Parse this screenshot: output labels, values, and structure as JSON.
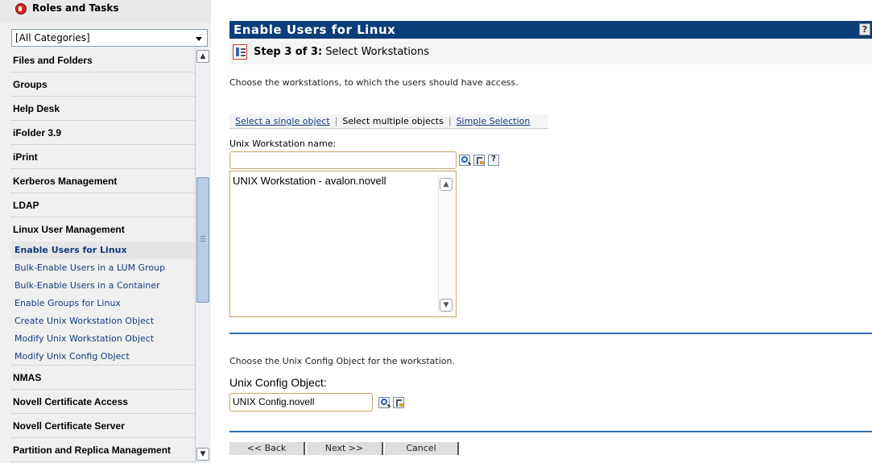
{
  "sidebar": {
    "header_title": "Roles and Tasks",
    "category_select": {
      "value": "[All Categories]"
    },
    "items": [
      {
        "label": "Files and Folders"
      },
      {
        "label": "Groups"
      },
      {
        "label": "Help Desk"
      },
      {
        "label": "iFolder 3.9"
      },
      {
        "label": "iPrint"
      },
      {
        "label": "Kerberos Management"
      },
      {
        "label": "LDAP"
      },
      {
        "label": "Linux User Management"
      },
      {
        "label": "NMAS"
      },
      {
        "label": "Novell Certificate Access"
      },
      {
        "label": "Novell Certificate Server"
      },
      {
        "label": "Partition and Replica Management"
      }
    ],
    "subitems": [
      {
        "label": "Enable Users for Linux"
      },
      {
        "label": "Bulk-Enable Users in a LUM Group"
      },
      {
        "label": "Bulk-Enable Users in a Container"
      },
      {
        "label": "Enable Groups for Linux"
      },
      {
        "label": "Create Unix Workstation Object"
      },
      {
        "label": "Modify Unix Workstation Object"
      },
      {
        "label": "Modify Unix Config Object"
      }
    ]
  },
  "main": {
    "title": "Enable Users for Linux",
    "help_label": "?",
    "step_prefix": "Step 3 of 3:",
    "step_title": "Select Workstations",
    "workstation_description": "Choose the workstations, to which the users should have access.",
    "selection_tabs": {
      "single": "Select a single object",
      "multiple": "Select multiple objects",
      "simple": "Simple Selection"
    },
    "workstation_field_label": "Unix Workstation name:",
    "workstation_input_value": "",
    "workstation_help": "?",
    "selected_workstations": [
      "UNIX Workstation - avalon.novell"
    ],
    "config_description": "Choose the Unix Config Object for the workstation.",
    "config_label": "Unix Config Object:",
    "config_value": "UNIX Config.novell"
  },
  "buttons": {
    "back": "<< Back",
    "next": "Next >>",
    "cancel": "Cancel"
  },
  "colors": {
    "title_bar": "#0b3d7a",
    "rule": "#2c71b3",
    "link": "#133a80"
  }
}
